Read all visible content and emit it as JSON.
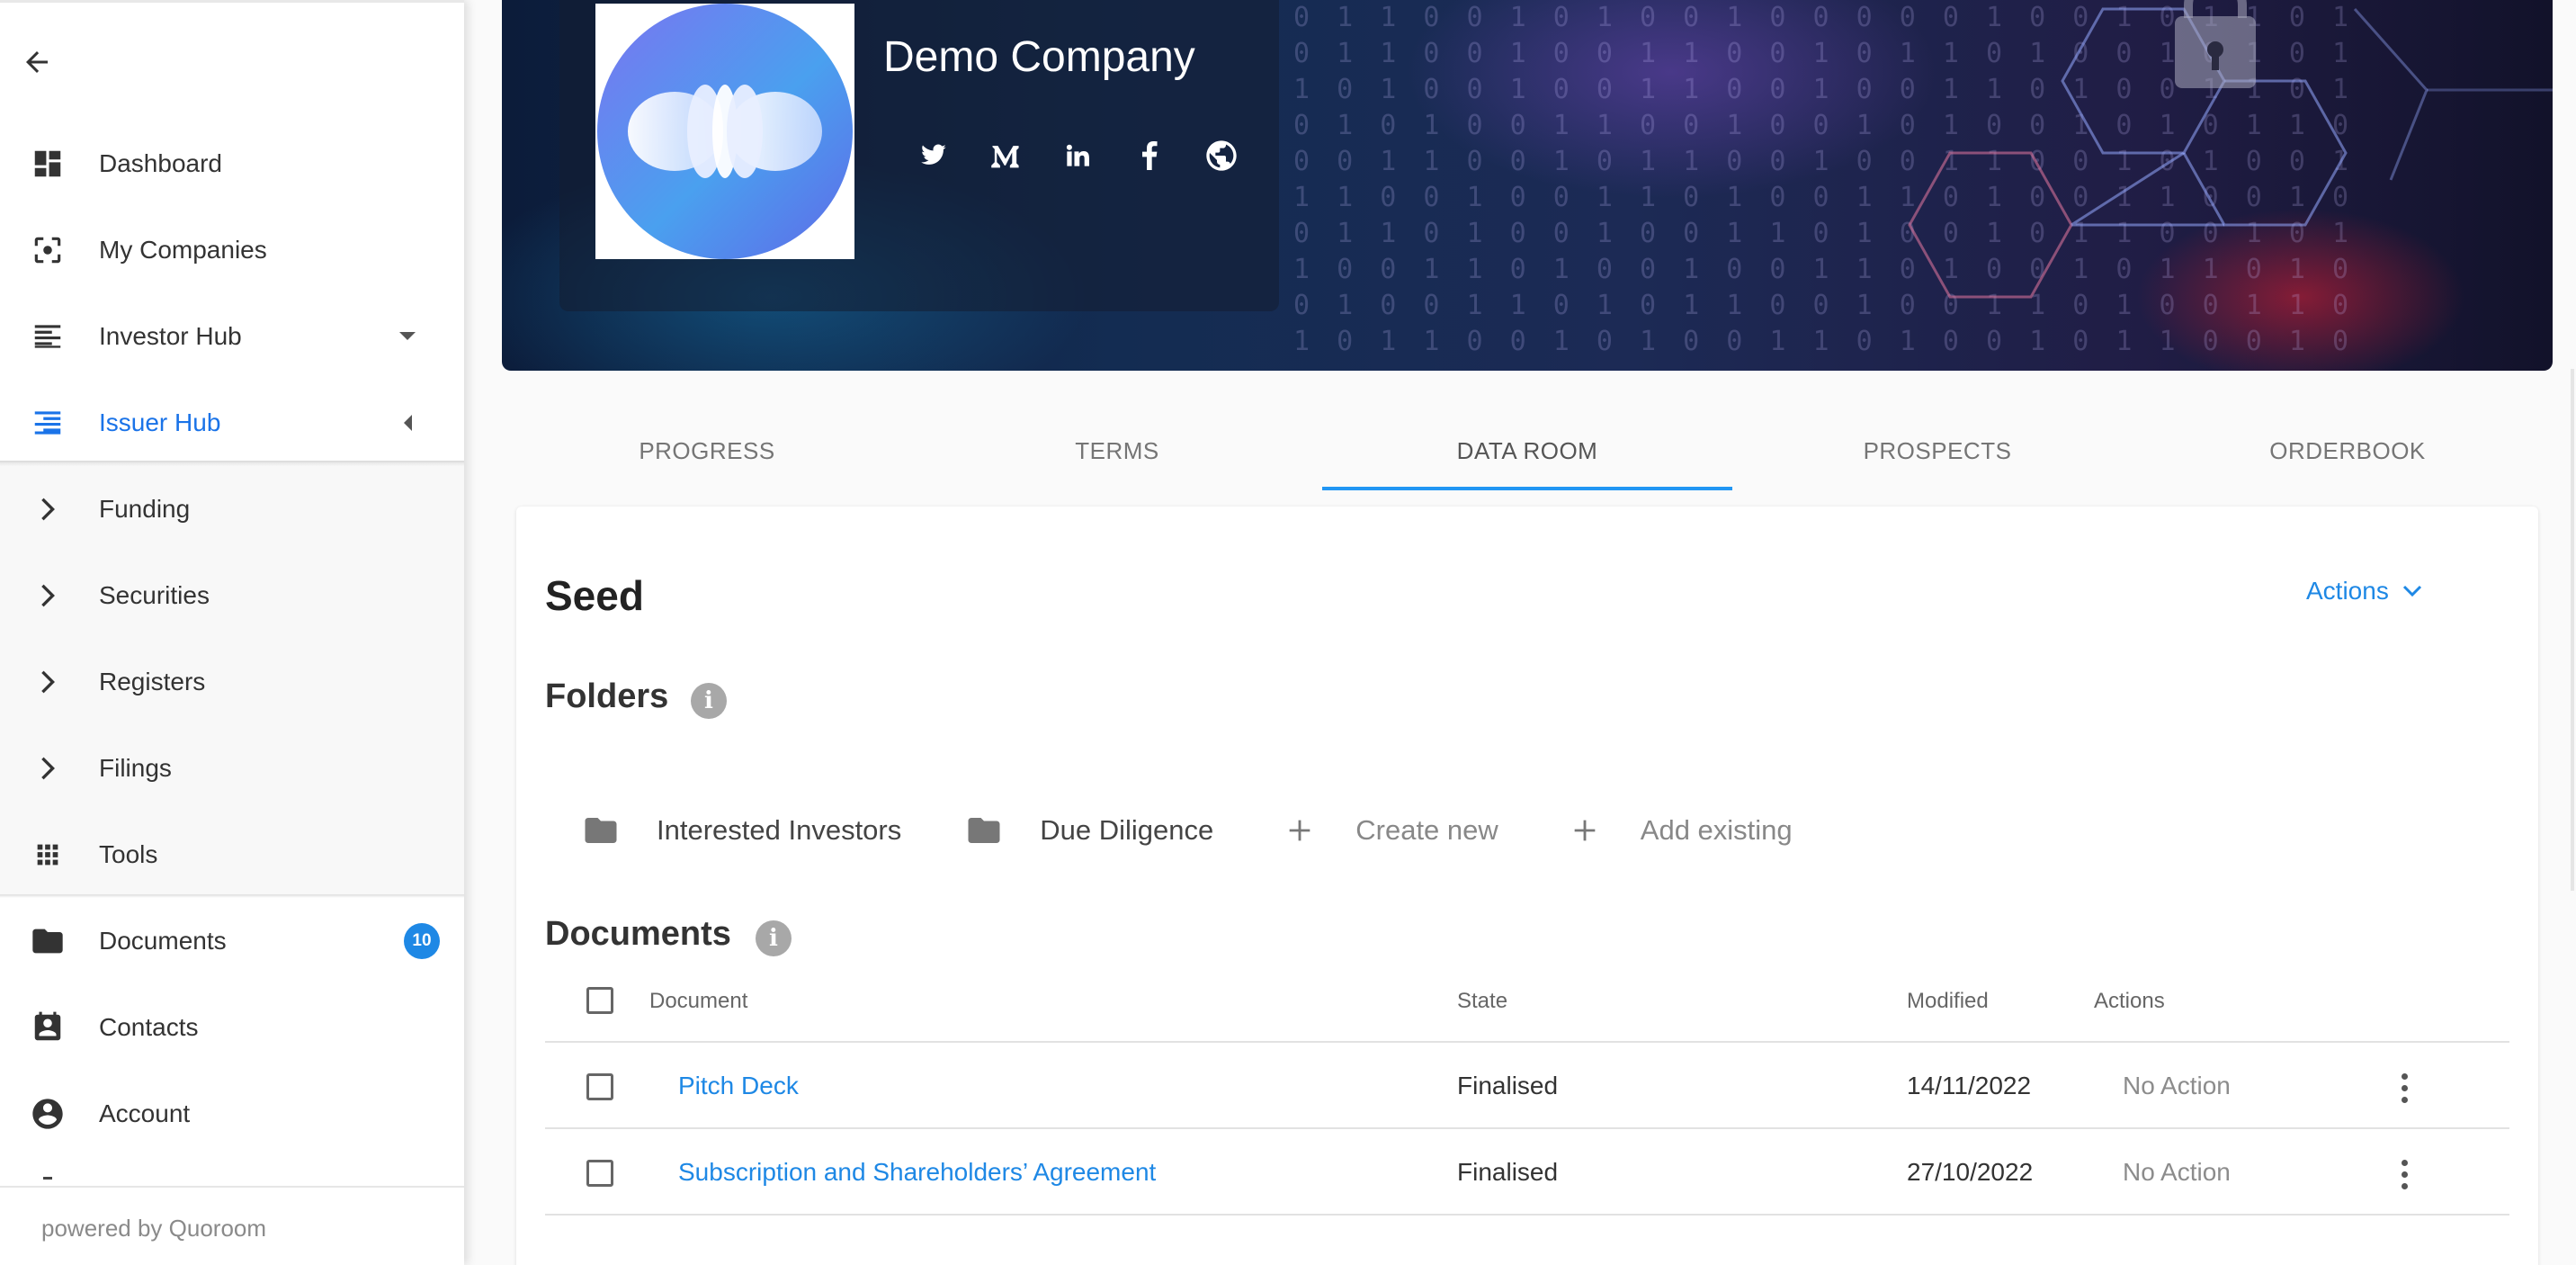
{
  "sidebar": {
    "nav": [
      {
        "label": "Dashboard",
        "icon": "dashboard-icon"
      },
      {
        "label": "My Companies",
        "icon": "center-focus-icon"
      },
      {
        "label": "Investor Hub",
        "icon": "notes-icon"
      },
      {
        "label": "Issuer Hub",
        "icon": "list-indent-icon"
      }
    ],
    "issuer_hub_children": [
      {
        "label": "Funding"
      },
      {
        "label": "Securities"
      },
      {
        "label": "Registers"
      },
      {
        "label": "Filings"
      },
      {
        "label": "Tools"
      }
    ],
    "bottom_nav": [
      {
        "label": "Documents",
        "badge": "10"
      },
      {
        "label": "Contacts"
      },
      {
        "label": "Account"
      }
    ],
    "footer": "powered by Quoroom"
  },
  "company": {
    "name": "Demo Company",
    "social_icons": [
      "twitter-icon",
      "medium-icon",
      "linkedin-icon",
      "facebook-icon",
      "globe-icon"
    ]
  },
  "tabs": [
    {
      "label": "PROGRESS"
    },
    {
      "label": "TERMS"
    },
    {
      "label": "DATA ROOM"
    },
    {
      "label": "PROSPECTS"
    },
    {
      "label": "ORDERBOOK"
    }
  ],
  "active_tab": "DATA ROOM",
  "data_room": {
    "title": "Seed",
    "actions_label": "Actions",
    "folders_title": "Folders",
    "folders": [
      {
        "label": "Interested Investors"
      },
      {
        "label": "Due Diligence"
      }
    ],
    "create_new_label": "Create new",
    "add_existing_label": "Add existing",
    "documents_title": "Documents",
    "columns": {
      "document": "Document",
      "state": "State",
      "modified": "Modified",
      "actions": "Actions"
    },
    "rows": [
      {
        "document": "Pitch Deck",
        "state": "Finalised",
        "modified": "14/11/2022",
        "action": "No Action"
      },
      {
        "document": "Subscription and Shareholders’ Agreement",
        "state": "Finalised",
        "modified": "27/10/2022",
        "action": "No Action"
      }
    ]
  },
  "colors": {
    "accent": "#1e88e5",
    "active_nav": "#1a73e8",
    "badge": "#1e88e5"
  }
}
